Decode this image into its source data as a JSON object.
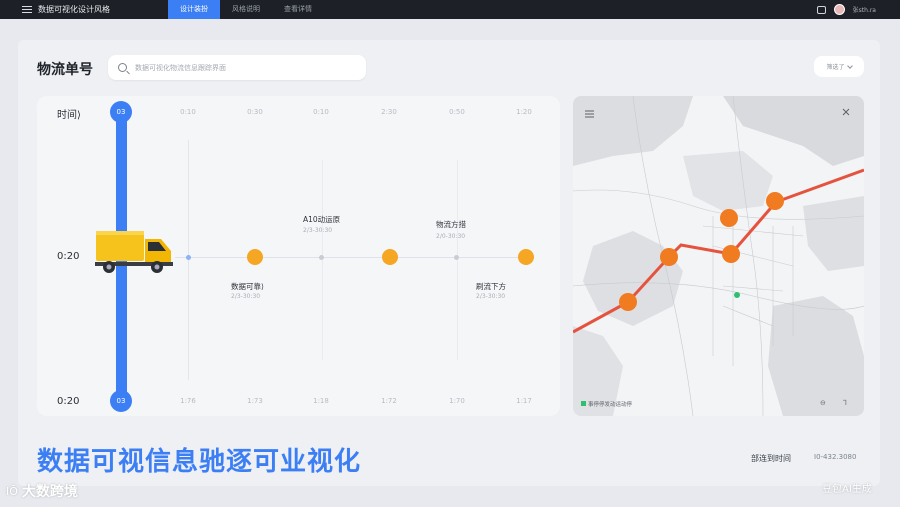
{
  "topbar": {
    "app_title": "数据可视化设计风格",
    "tabs": [
      {
        "label": "设计装扮",
        "active": true
      },
      {
        "label": "风格说明",
        "active": false
      },
      {
        "label": "查看详情",
        "active": false
      }
    ],
    "user_name": "张sth.ra"
  },
  "header": {
    "order_label": "物流单号",
    "search_placeholder": "数据可视化物流信息跟踪界面",
    "dropdown_label": "筛选了"
  },
  "timeline": {
    "row_label_top": "时间⟩",
    "row_label_mid": "0:20",
    "row_label_bottom": "0:20",
    "knob_top": "03",
    "knob_bottom": "03",
    "column_heads": [
      "0:10",
      "0:30",
      "0:10",
      "2:30",
      "0:50",
      "1:20"
    ],
    "column_foots": [
      "1:76",
      "1:73",
      "1:18",
      "1:72",
      "1:70",
      "1:17"
    ],
    "events": [
      {
        "title": "数据可靠⟩",
        "time": "2/3-30:30"
      },
      {
        "title": "A10动运原",
        "time": "2/3-30:30"
      },
      {
        "title": "物流方措",
        "time": "2/0-30:30"
      },
      {
        "title": "刷流下方",
        "time": "2/3-30:30"
      }
    ]
  },
  "map": {
    "footer_text": "事停停发动运动停",
    "controls": [
      "⊖",
      "⅂"
    ]
  },
  "footer": {
    "headline": "数据可视信息驰逐可业视化",
    "label": "部连到时间",
    "value": "Ⅰ0-432.3080"
  },
  "watermark": {
    "left_logo": "IŌ",
    "left_text": "大数跨境",
    "right_text": "豆包AI生成"
  },
  "colors": {
    "accent": "#3c7ff5",
    "node": "#f5a623",
    "route": "#e5533f",
    "map_node": "#f07b20"
  }
}
